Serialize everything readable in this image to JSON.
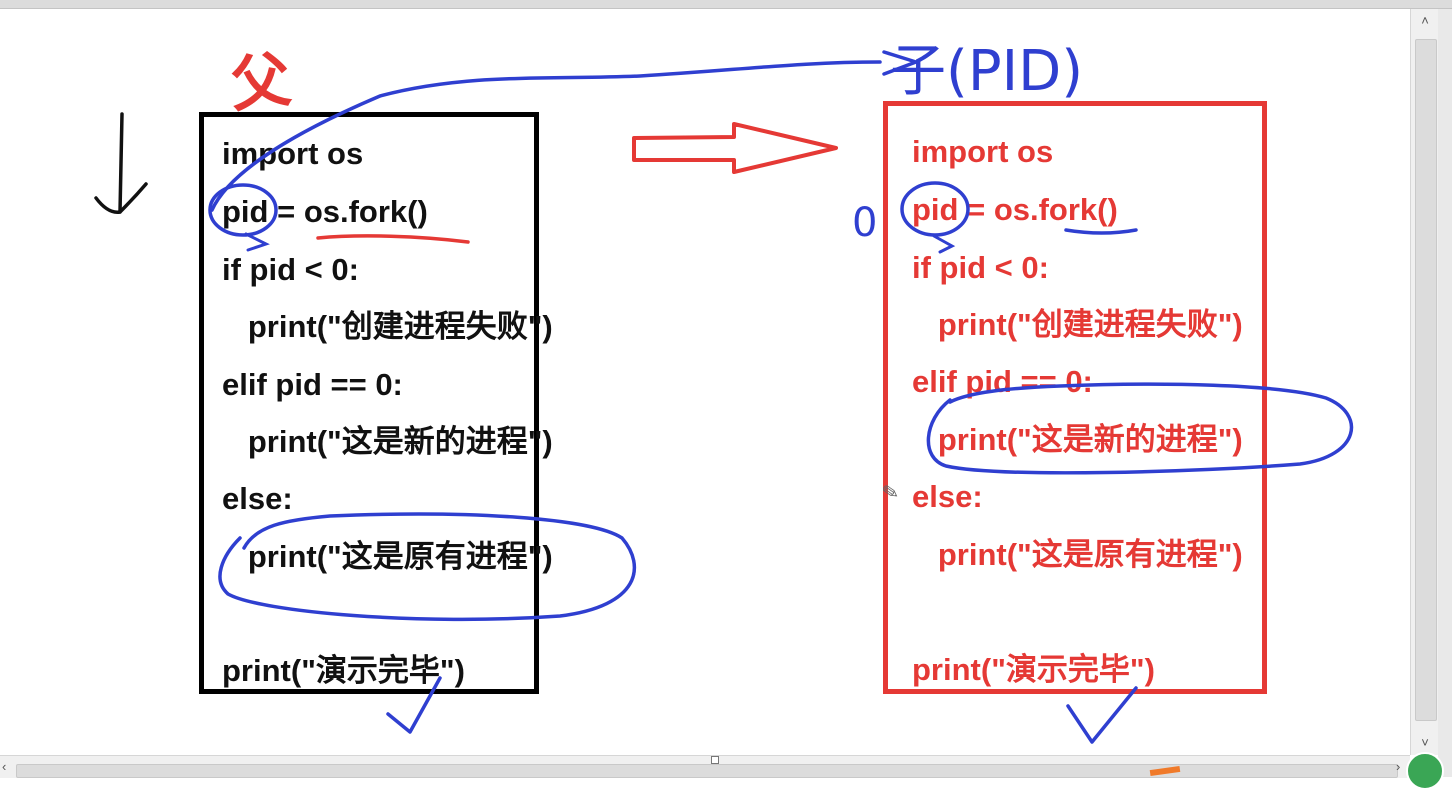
{
  "parent_code": {
    "lines": [
      "import os",
      "pid = os.fork()",
      "if pid < 0:",
      "   print(\"创建进程失败\")",
      "elif pid == 0:",
      "   print(\"这是新的进程\")",
      "else:",
      "   print(\"这是原有进程\")",
      "print(\"演示完毕\")"
    ]
  },
  "child_code": {
    "lines": [
      "import os",
      "pid = os.fork()",
      "if pid < 0:",
      "   print(\"创建进程失败\")",
      "elif pid == 0:",
      "   print(\"这是新的进程\")",
      "else:",
      "   print(\"这是原有进程\")",
      "print(\"演示完毕\")"
    ]
  },
  "annotations": {
    "parent_label": "父",
    "child_label": "子(PID)",
    "child_pid_value": "0"
  },
  "colors": {
    "parent_border": "#000000",
    "child_border": "#e53935",
    "ink_blue": "#2f3fd0",
    "ink_red": "#e53935"
  },
  "icons": {
    "scroll_up": "chevron-up-icon",
    "scroll_down": "chevron-down-icon",
    "scroll_left": "chevron-left-icon",
    "scroll_right": "chevron-right-icon",
    "cursor": "pencil-cursor-icon"
  }
}
